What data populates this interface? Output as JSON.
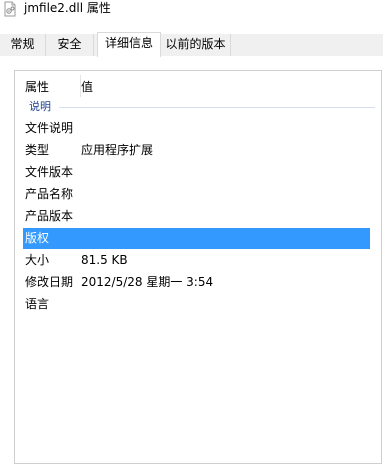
{
  "window": {
    "title": "jmfile2.dll 属性",
    "icon": "dll-file-icon"
  },
  "tabs": [
    {
      "label": "常规",
      "active": false
    },
    {
      "label": "安全",
      "active": false
    },
    {
      "label": "详细信息",
      "active": true
    },
    {
      "label": "以前的版本",
      "active": false
    }
  ],
  "details": {
    "columns": {
      "property": "属性",
      "value": "值"
    },
    "group": "说明",
    "rows": [
      {
        "name": "文件说明",
        "value": ""
      },
      {
        "name": "类型",
        "value": "应用程序扩展"
      },
      {
        "name": "文件版本",
        "value": ""
      },
      {
        "name": "产品名称",
        "value": ""
      },
      {
        "name": "产品版本",
        "value": ""
      },
      {
        "name": "版权",
        "value": "",
        "selected": true
      },
      {
        "name": "大小",
        "value": "81.5 KB"
      },
      {
        "name": "修改日期",
        "value": "2012/5/28 星期一 3:54"
      },
      {
        "name": "语言",
        "value": ""
      }
    ]
  },
  "colors": {
    "selection": "#3399ff",
    "group_label": "#1e3f8f"
  }
}
